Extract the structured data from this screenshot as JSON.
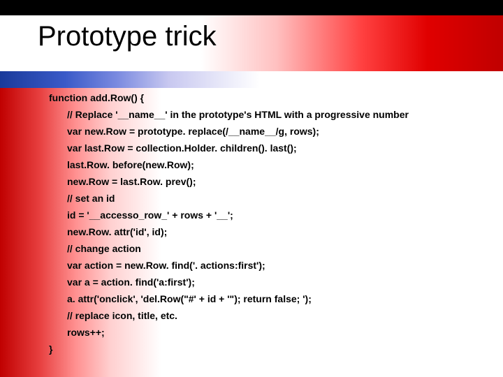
{
  "title": "Prototype trick",
  "code": {
    "l1": "function add.Row() {",
    "l2": "// Replace '__name__' in the prototype's HTML with a progressive number",
    "l3": "var new.Row = prototype. replace(/__name__/g, rows);",
    "l4": "var last.Row = collection.Holder. children(). last();",
    "l5": "last.Row. before(new.Row);",
    "l6": "new.Row = last.Row. prev();",
    "l7": "// set an id",
    "l8": "id = '__accesso_row_' + rows + '__';",
    "l9": "new.Row. attr('id', id);",
    "l10": "// change action",
    "l11": "var action = new.Row. find('. actions:first');",
    "l12": "var a = action. find('a:first');",
    "l13": "a. attr('onclick', 'del.Row(\"#' + id + '\"); return false; ');",
    "l14": "// replace icon, title, etc.",
    "l15": "rows++;",
    "l16": "}"
  }
}
